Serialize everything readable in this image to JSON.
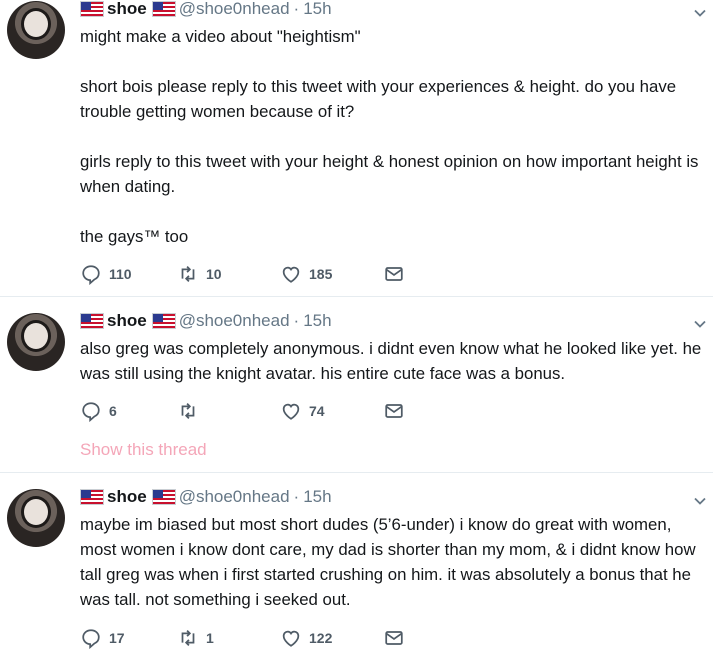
{
  "colors": {
    "accent": "#e0245e",
    "text": "#14171a",
    "muted": "#657786",
    "show_thread": "#f4a6b8"
  },
  "tweets": [
    {
      "name": "shoe",
      "handle": "@shoe0nhead",
      "separator": "·",
      "time": "15h",
      "text": "might make a video about \"heightism\"\n\nshort bois please reply to this tweet with your experiences & height. do you have trouble getting women because of it?\n\ngirls reply to this tweet with your height & honest opinion on how important height is when dating.\n\nthe gays™ too",
      "replies": "110",
      "retweets": "10",
      "likes": "185"
    },
    {
      "name": "shoe",
      "handle": "@shoe0nhead",
      "separator": "·",
      "time": "15h",
      "text": "also greg was completely anonymous. i didnt even know what he looked like yet. he was still using the knight avatar. his entire cute face was a bonus.",
      "replies": "6",
      "retweets": "",
      "likes": "74",
      "show_thread": "Show this thread"
    },
    {
      "name": "shoe",
      "handle": "@shoe0nhead",
      "separator": "·",
      "time": "15h",
      "text": "maybe im biased but most short dudes (5’6-under) i know do great with women, most women i know dont care, my dad is shorter than my mom, & i didnt know how tall greg was when i first started crushing on him. it was absolutely a bonus that he was tall. not something i seeked out.",
      "replies": "17",
      "retweets": "1",
      "likes": "122"
    }
  ],
  "icons": {
    "reply": "reply-icon",
    "retweet": "retweet-icon",
    "like": "heart-icon",
    "message": "envelope-icon",
    "menu": "chevron-down-icon",
    "flag": "us-flag-icon"
  }
}
